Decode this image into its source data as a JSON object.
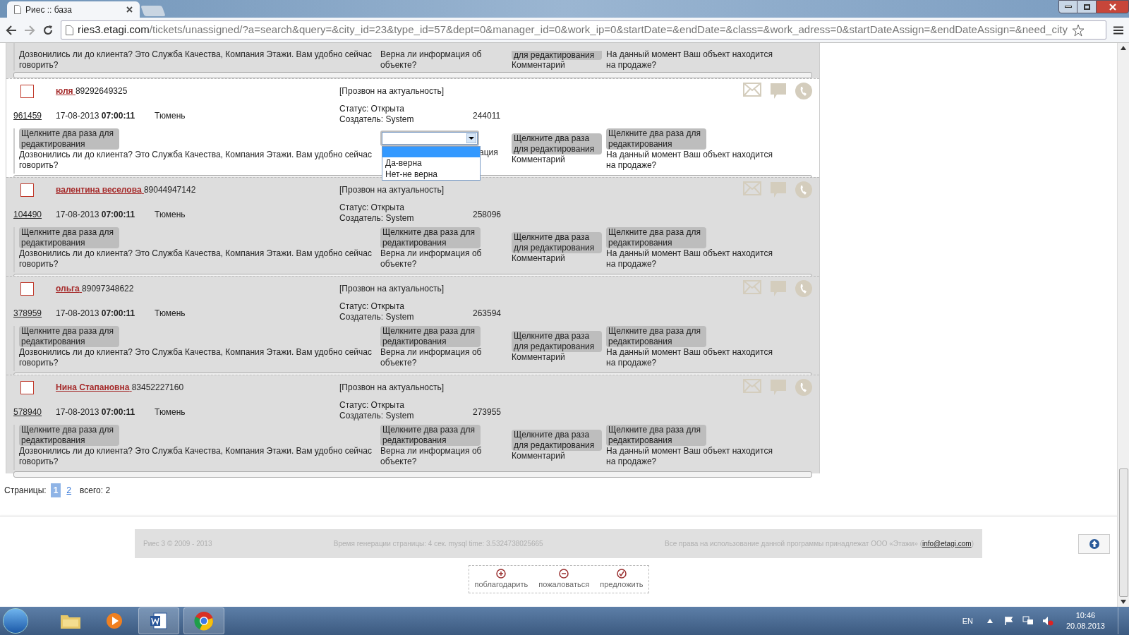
{
  "browser": {
    "tab_title": "Риес :: база",
    "url_host": "ries3.etagi.com",
    "url_path": "/tickets/unassigned/?a=search&query=&city_id=23&type_id=57&dept=0&manager_id=0&work_ip=0&startDate=&endDate=&class=&work_adress=0&startDateAssign=&endDateAssign=&need_city"
  },
  "partial_row": {
    "fields": [
      {
        "text": "Дозвонились ли до клиента? Это Служба Качества, Компания Этажи. Вам удобно сейчас говорить?"
      },
      {
        "text": "Верна ли информация об объекте?"
      },
      {
        "label": "для редактирования",
        "text": "Комментарий"
      },
      {
        "text": "На данный момент Ваш объект находится на продаже?"
      }
    ]
  },
  "tickets": [
    {
      "active": true,
      "checked": false,
      "name": "юля",
      "phone": "89292649325",
      "type": "[Прозвон на актуальность]",
      "id": "961459",
      "date": "17-08-2013",
      "time": "07:00:11",
      "city": "Тюмень",
      "status": "Статус: Открыта",
      "creator": "Создатель: System",
      "number": "244011",
      "fields": [
        {
          "kind": "label",
          "label": "Щелкните два раза для редактирования",
          "text": "Дозвонились ли до клиента? Это Служба Качества, Компания Этажи. Вам удобно сейчас говорить?"
        },
        {
          "kind": "select",
          "options": [
            {
              "label": "Да-верна",
              "selected": false
            },
            {
              "label": "Нет-не верна",
              "selected": false
            }
          ],
          "text": "ация"
        },
        {
          "kind": "label",
          "label": "Щелкните два раза для редактирования",
          "text": "Комментарий"
        },
        {
          "kind": "label",
          "label": "Щелкните два раза для редактирования",
          "text": "На данный момент Ваш объект находится на продаже?"
        }
      ]
    },
    {
      "active": false,
      "checked": false,
      "name": "валентина веселова",
      "phone": "89044947142",
      "type": "[Прозвон на актуальность]",
      "id": "104490",
      "date": "17-08-2013",
      "time": "07:00:11",
      "city": "Тюмень",
      "status": "Статус: Открыта",
      "creator": "Создатель: System",
      "number": "258096",
      "fields": [
        {
          "kind": "label",
          "label": "Щелкните два раза для редактирования",
          "text": "Дозвонились ли до клиента? Это Служба Качества, Компания Этажи. Вам удобно сейчас говорить?"
        },
        {
          "kind": "label",
          "label": "Щелкните два раза для редактирования",
          "text": "Верна ли информация об объекте?"
        },
        {
          "kind": "label",
          "label": "Щелкните два раза для редактирования",
          "text": "Комментарий"
        },
        {
          "kind": "label",
          "label": "Щелкните два раза для редактирования",
          "text": "На данный момент Ваш объект находится на продаже?"
        }
      ]
    },
    {
      "active": false,
      "checked": false,
      "name": "ольга",
      "phone": "89097348622",
      "type": "[Прозвон на актуальность]",
      "id": "378959",
      "date": "17-08-2013",
      "time": "07:00:11",
      "city": "Тюмень",
      "status": "Статус: Открыта",
      "creator": "Создатель: System",
      "number": "263594",
      "fields": [
        {
          "kind": "label",
          "label": "Щелкните два раза для редактирования",
          "text": "Дозвонились ли до клиента? Это Служба Качества, Компания Этажи. Вам удобно сейчас говорить?"
        },
        {
          "kind": "label",
          "label": "Щелкните два раза для редактирования",
          "text": "Верна ли информация об объекте?"
        },
        {
          "kind": "label",
          "label": "Щелкните два раза для редактирования",
          "text": "Комментарий"
        },
        {
          "kind": "label",
          "label": "Щелкните два раза для редактирования",
          "text": "На данный момент Ваш объект находится на продаже?"
        }
      ]
    },
    {
      "active": false,
      "checked": false,
      "name": "Нина Стапановна",
      "phone": "83452227160",
      "type": "[Прозвон на актуальность]",
      "id": "578940",
      "date": "17-08-2013",
      "time": "07:00:11",
      "city": "Тюмень",
      "status": "Статус: Открыта",
      "creator": "Создатель: System",
      "number": "273955",
      "fields": [
        {
          "kind": "label",
          "label": "Щелкните два раза для редактирования",
          "text": "Дозвонились ли до клиента? Это Служба Качества, Компания Этажи. Вам удобно сейчас говорить?"
        },
        {
          "kind": "label",
          "label": "Щелкните два раза для редактирования",
          "text": "Верна ли информация об объекте?"
        },
        {
          "kind": "label",
          "label": "Щелкните два раза для редактирования",
          "text": "Комментарий"
        },
        {
          "kind": "label",
          "label": "Щелкните два раза для редактирования",
          "text": "На данный момент Ваш объект находится на продаже?"
        }
      ]
    }
  ],
  "pagination": {
    "label": "Страницы:",
    "pages": [
      {
        "label": "1",
        "selected": true
      },
      {
        "label": "2",
        "selected": false
      }
    ],
    "total": "всего: 2"
  },
  "footer": {
    "copyright": "Риес 3 © 2009 - 2013",
    "generation": "Время генерации страницы: 4 сек. mysql time: 3.5324738025665",
    "rights": "Все права на использование данной программы принадлежат ООО «Этажи» (",
    "email": "info@etagi.com",
    "rights_end": ")"
  },
  "feedback": [
    {
      "kind": "plus",
      "label": "поблагодарить"
    },
    {
      "kind": "minus",
      "label": "пожаловаться"
    },
    {
      "kind": "check",
      "label": "предложить"
    }
  ],
  "taskbar": {
    "language": "EN",
    "time": "10:46",
    "date": "20.08.2013"
  }
}
